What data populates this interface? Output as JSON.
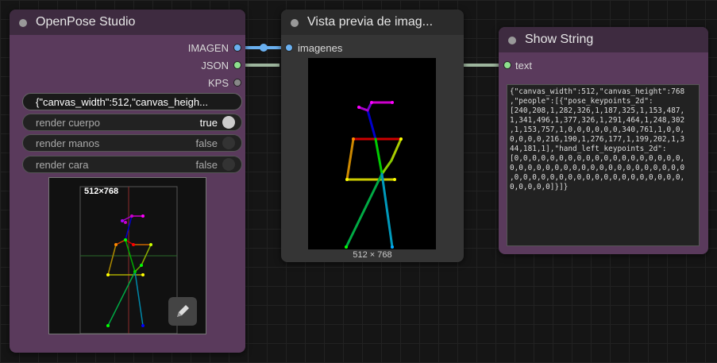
{
  "openpose": {
    "title": "OpenPose Studio",
    "outputs": [
      "IMAGEN",
      "JSON",
      "KPS"
    ],
    "json_preview": "{\"canvas_width\":512,\"canvas_heigh...",
    "toggles": [
      {
        "label": "render cuerpo",
        "value": "true",
        "on": true
      },
      {
        "label": "render manos",
        "value": "false",
        "on": false
      },
      {
        "label": "render cara",
        "value": "false",
        "on": false
      }
    ],
    "canvas_size_label": "512×768"
  },
  "preview": {
    "title": "Vista previa de imag...",
    "input_label": "imagenes",
    "size_caption": "512 × 768"
  },
  "show_string": {
    "title": "Show String",
    "input_label": "text",
    "text": "{\"canvas_width\":512,\"canvas_height\":768\n,\"people\":[{\"pose_keypoints_2d\":\n[240,208,1,282,326,1,187,325,1,153,487,\n1,341,496,1,377,326,1,291,464,1,248,302\n,1,153,757,1,0,0,0,0,0,0,340,761,1,0,0,\n0,0,0,0,216,190,1,276,177,1,199,202,1,3\n44,181,1],\"hand_left_keypoints_2d\":\n[0,0,0,0,0,0,0,0,0,0,0,0,0,0,0,0,0,0,0,\n0,0,0,0,0,0,0,0,0,0,0,0,0,0,0,0,0,0,0,0\n,0,0,0,0,0,0,0,0,0,0,0,0,0,0,0,0,0,0,0,\n0,0,0,0,0]}]}"
  },
  "colors": {
    "node_purple_body": "#5a3a5c",
    "node_purple_title": "#3e2b40",
    "node_gray_body": "#353535",
    "node_gray_title": "#2b2b2b",
    "link_image": "#6ab0f0",
    "link_json": "#9db59d"
  }
}
